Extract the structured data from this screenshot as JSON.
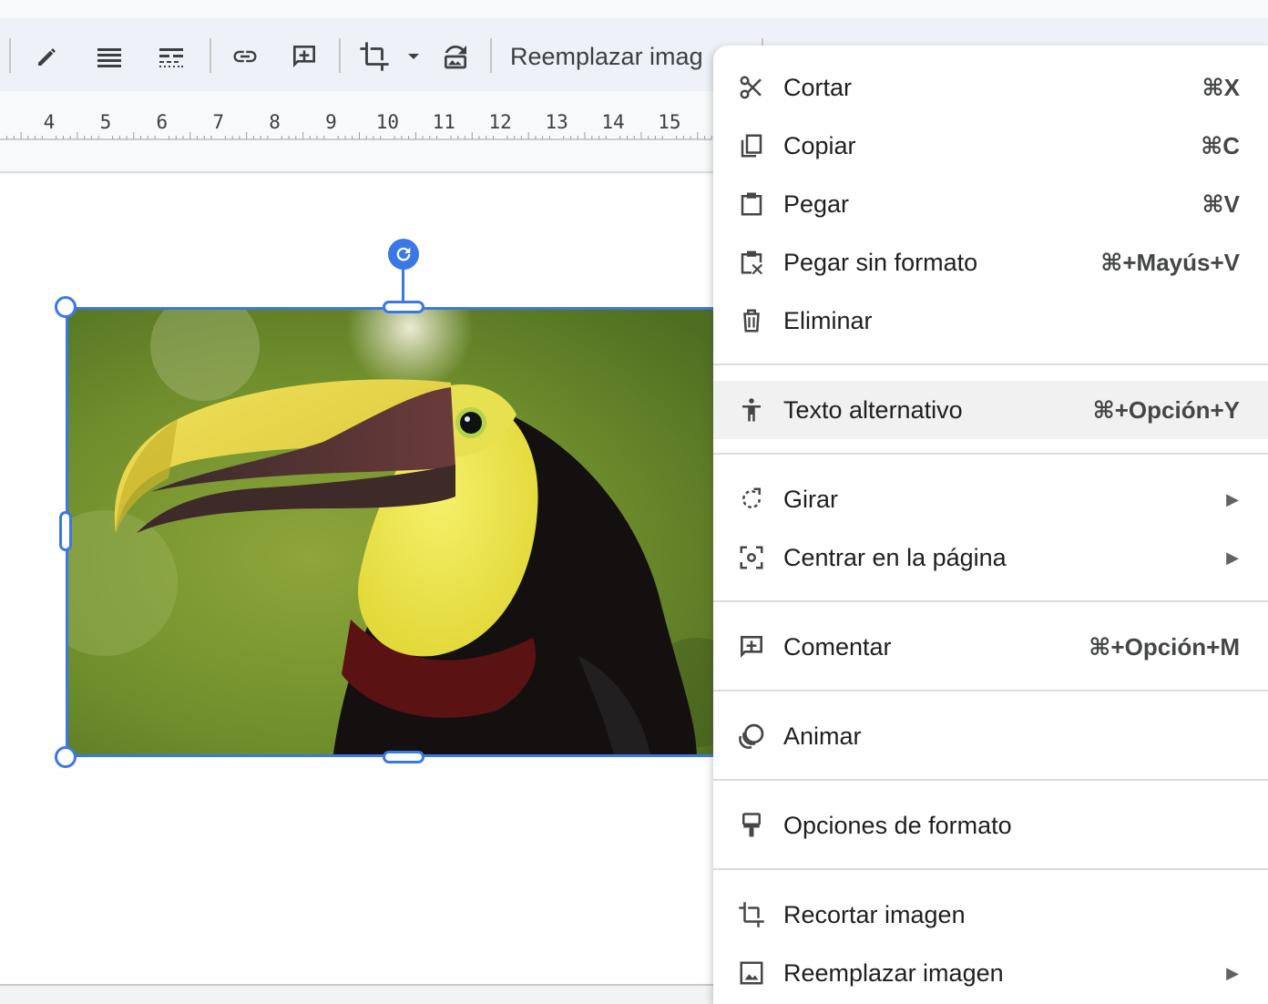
{
  "toolbar": {
    "replace_image_label": "Reemplazar imag",
    "hidden_label": "Opciones de formato",
    "icons": [
      "pencil-icon",
      "align-justify-icon",
      "line-style-icon",
      "link-icon",
      "add-comment-icon",
      "crop-icon",
      "dropdown-arrow-icon",
      "reset-image-icon"
    ]
  },
  "ruler": {
    "labels": [
      "4",
      "5",
      "6",
      "7",
      "8",
      "9",
      "10",
      "11",
      "12",
      "13",
      "14",
      "15"
    ]
  },
  "image": {
    "subject": "toucan photo",
    "selected": true,
    "selection_color": "#3b78e7"
  },
  "context_menu": {
    "groups": [
      [
        {
          "label": "Cortar",
          "shortcut": "⌘X",
          "icon": "scissors-icon"
        },
        {
          "label": "Copiar",
          "shortcut": "⌘C",
          "icon": "copy-icon"
        },
        {
          "label": "Pegar",
          "shortcut": "⌘V",
          "icon": "paste-icon"
        },
        {
          "label": "Pegar sin formato",
          "shortcut": "⌘+Mayús+V",
          "icon": "paste-plain-icon"
        },
        {
          "label": "Eliminar",
          "shortcut": "",
          "icon": "trash-icon"
        }
      ],
      [
        {
          "label": "Texto alternativo",
          "shortcut": "⌘+Opción+Y",
          "icon": "accessibility-icon",
          "highlighted": true
        }
      ],
      [
        {
          "label": "Girar",
          "submenu": true,
          "icon": "rotate-icon"
        },
        {
          "label": "Centrar en la página",
          "submenu": true,
          "icon": "center-icon"
        }
      ],
      [
        {
          "label": "Comentar",
          "shortcut": "⌘+Opción+M",
          "icon": "add-comment-icon"
        }
      ],
      [
        {
          "label": "Animar",
          "shortcut": "",
          "icon": "animate-icon"
        }
      ],
      [
        {
          "label": "Opciones de formato",
          "shortcut": "",
          "icon": "format-paint-icon"
        }
      ],
      [
        {
          "label": "Recortar imagen",
          "shortcut": "",
          "icon": "crop-icon"
        },
        {
          "label": "Reemplazar imagen",
          "submenu": true,
          "icon": "image-icon"
        }
      ]
    ],
    "submenu_arrow": "▶",
    "highlight_color": "#f1f1f1"
  }
}
